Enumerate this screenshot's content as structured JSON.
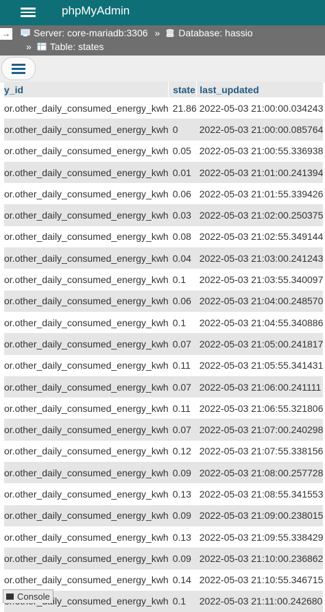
{
  "app": {
    "title": "phpMyAdmin"
  },
  "breadcrumb": {
    "arrow": "→",
    "server": "Server: core-mariadb:3306",
    "separator": "»",
    "database": "Database: hassio",
    "table": "Table: states"
  },
  "table": {
    "headers": [
      "y_id",
      "state",
      "last_updated"
    ],
    "rows": [
      [
        "or.other_daily_consumed_energy_kwh",
        "21.86",
        "2022-05-03 21:00:00.034243"
      ],
      [
        "or.other_daily_consumed_energy_kwh",
        "0",
        "2022-05-03 21:00:00.085764"
      ],
      [
        "or.other_daily_consumed_energy_kwh",
        "0.05",
        "2022-05-03 21:00:55.336938"
      ],
      [
        "or.other_daily_consumed_energy_kwh",
        "0.01",
        "2022-05-03 21:01:00.241394"
      ],
      [
        "or.other_daily_consumed_energy_kwh",
        "0.06",
        "2022-05-03 21:01:55.339426"
      ],
      [
        "or.other_daily_consumed_energy_kwh",
        "0.03",
        "2022-05-03 21:02:00.250375"
      ],
      [
        "or.other_daily_consumed_energy_kwh",
        "0.08",
        "2022-05-03 21:02:55.349144"
      ],
      [
        "or.other_daily_consumed_energy_kwh",
        "0.04",
        "2022-05-03 21:03:00.241243"
      ],
      [
        "or.other_daily_consumed_energy_kwh",
        "0.1",
        "2022-05-03 21:03:55.340097"
      ],
      [
        "or.other_daily_consumed_energy_kwh",
        "0.06",
        "2022-05-03 21:04:00.248570"
      ],
      [
        "or.other_daily_consumed_energy_kwh",
        "0.1",
        "2022-05-03 21:04:55.340886"
      ],
      [
        "or.other_daily_consumed_energy_kwh",
        "0.07",
        "2022-05-03 21:05:00.241817"
      ],
      [
        "or.other_daily_consumed_energy_kwh",
        "0.11",
        "2022-05-03 21:05:55.341431"
      ],
      [
        "or.other_daily_consumed_energy_kwh",
        "0.07",
        "2022-05-03 21:06:00.241111"
      ],
      [
        "or.other_daily_consumed_energy_kwh",
        "0.11",
        "2022-05-03 21:06:55.321806"
      ],
      [
        "or.other_daily_consumed_energy_kwh",
        "0.07",
        "2022-05-03 21:07:00.240298"
      ],
      [
        "or.other_daily_consumed_energy_kwh",
        "0.12",
        "2022-05-03 21:07:55.338156"
      ],
      [
        "or.other_daily_consumed_energy_kwh",
        "0.09",
        "2022-05-03 21:08:00.257728"
      ],
      [
        "or.other_daily_consumed_energy_kwh",
        "0.13",
        "2022-05-03 21:08:55.341553"
      ],
      [
        "or.other_daily_consumed_energy_kwh",
        "0.09",
        "2022-05-03 21:09:00.238015"
      ],
      [
        "or.other_daily_consumed_energy_kwh",
        "0.13",
        "2022-05-03 21:09:55.338429"
      ],
      [
        "or.other_daily_consumed_energy_kwh",
        "0.09",
        "2022-05-03 21:10:00.236862"
      ],
      [
        "or.other_daily_consumed_energy_kwh",
        "0.14",
        "2022-05-03 21:10:55.346715"
      ],
      [
        "or.other_daily_consumed_energy_kwh",
        "0.1",
        "2022-05-03 21:11:00.242680"
      ]
    ]
  },
  "console": {
    "label": "Console"
  },
  "icons": {
    "menu": "hamburger-icon",
    "server": "server-icon",
    "database": "database-icon",
    "table": "table-icon",
    "console": "console-icon"
  },
  "colors": {
    "topbar": "#0f6f76",
    "breadcrumb": "#6f6f6f",
    "header_text": "#235a81"
  }
}
